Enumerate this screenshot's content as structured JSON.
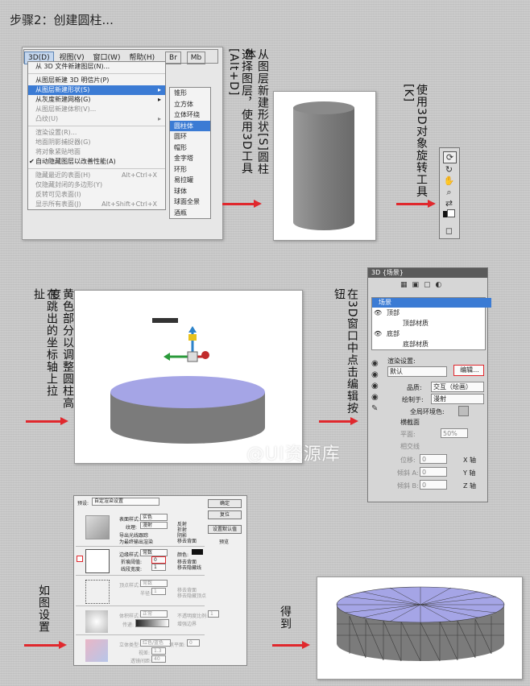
{
  "title": "步骤2：创建圆柱...",
  "menubar": {
    "items": [
      "3D(D)",
      "视图(V)",
      "窗口(W)",
      "帮助(H)"
    ],
    "icons": [
      "Br",
      "Mb"
    ]
  },
  "menu": {
    "items": [
      {
        "label": "从 3D 文件新建图层(N)...",
        "state": "normal"
      },
      {
        "label": "从图层新建 3D 明信片(P)",
        "state": "normal"
      },
      {
        "label": "从图层新建形状(S)",
        "state": "highlight"
      },
      {
        "label": "从灰度新建网格(G)",
        "state": "normal"
      },
      {
        "label": "从图层新建体积(V)...",
        "state": "disabled"
      },
      {
        "label": "凸纹(U)",
        "state": "disabled"
      },
      {
        "label": "渲染设置(R)...",
        "state": "disabled"
      },
      {
        "label": "地面阴影捕捉器(G)",
        "state": "disabled"
      },
      {
        "label": "将对象紧贴地面",
        "state": "disabled"
      },
      {
        "label": "自动隐藏图层以改善性能(A)",
        "state": "checked"
      },
      {
        "label": "隐藏最近的表面(H)",
        "shortcut": "Alt+Ctrl+X",
        "state": "disabled"
      },
      {
        "label": "仅隐藏封闭的多边形(Y)",
        "state": "disabled"
      },
      {
        "label": "反转可见表面(I)",
        "state": "disabled"
      },
      {
        "label": "显示所有表面(J)",
        "shortcut": "Alt+Shift+Ctrl+X",
        "state": "disabled"
      }
    ],
    "submenu": [
      "锥形",
      "立方体",
      "立体环绕",
      "圆柱体",
      "圆环",
      "帽形",
      "金字塔",
      "环形",
      "易拉罐",
      "球体",
      "球面全景",
      "酒瓶"
    ],
    "submenu_selected": "圆柱体"
  },
  "captions": {
    "step1": "从图层新建形状[S]圆柱体",
    "step1b": "选择图层，使用3D工具[Alt+D]",
    "step2": "使用3D对象旋转工具[K]",
    "step3a": "黄色部分以调整圆柱高度",
    "step3b": "在跳出的坐标轴上拉扯",
    "step4": "在3D窗口中点击编辑按钮",
    "step5": "如图设置",
    "step6": "得到"
  },
  "panel3d": {
    "title": "3D {场景}",
    "tree": [
      {
        "label": "场景",
        "level": 0,
        "selected": true
      },
      {
        "label": "顶部",
        "level": 1
      },
      {
        "label": "顶部材质",
        "level": 2
      },
      {
        "label": "底部",
        "level": 1
      },
      {
        "label": "底部材质",
        "level": 2
      }
    ],
    "render_label": "渲染设置:",
    "render_value": "默认",
    "edit_button": "编辑...",
    "quality_label": "品质:",
    "quality_value": "交互（绘画）",
    "paint_label": "绘制于:",
    "paint_value": "漫射",
    "ambient_label": "全局环境色:",
    "cross_label": "横截面",
    "plane_label": "平面:",
    "plane_value": "50%",
    "intersect_label": "相交线",
    "offset_label": "位移:",
    "tilt_a": "倾斜 A:",
    "tilt_b": "倾斜 B:",
    "axes": [
      "X 轴",
      "Y 轴",
      "Z 轴"
    ],
    "zero": "0"
  },
  "dialog": {
    "preset_label": "预设:",
    "preset_value": "自定渲染设置",
    "buttons": [
      "确定",
      "复位",
      "设置默认值"
    ],
    "preview": "预览",
    "face_style_label": "表面样式:",
    "face_style_value": "实色",
    "texture_label": "纹理:",
    "texture_value": "漫射",
    "face_checks": [
      "反射",
      "折射",
      "阴影",
      "移去背面"
    ],
    "export_label": "导出光线跟踪",
    "for_final": "为最终输出渲染",
    "edge_style_label": "边缘样式:",
    "edge_style_value": "常数",
    "crease_label": "折痕阈值:",
    "crease_value": "0",
    "line_width_label": "线段宽度:",
    "line_width_value": "1",
    "color_label": "颜色:",
    "edge_checks": [
      "移去背面",
      "移去隐藏线"
    ],
    "vertex_label": "顶点样式:",
    "vertex_value": "常数",
    "radius_label": "半径:",
    "radius_value": "1",
    "vertex_checks": [
      "移去背面",
      "移去隐藏顶点"
    ],
    "volume_label": "体积样式:",
    "volume_value": "正常",
    "transfer_label": "传递:",
    "opacity_label": "不透明度比例:",
    "opacity_value": "1",
    "enhance_label": "增强边界",
    "stereo_label": "立体类型:",
    "stereo_value": "红色/蓝色",
    "parallax_label": "视差:",
    "parallax_value": "1.3",
    "spacing_label": "透镜间距:",
    "spacing_value": "40",
    "focal_label": "焦平面:",
    "focal_value": "0"
  },
  "watermark": "@UI资源库",
  "colors": {
    "arrow": "#e0282d",
    "cap": "#a5a5e6",
    "side": "#7b7b7b",
    "highlight": "#3b7bd4"
  }
}
